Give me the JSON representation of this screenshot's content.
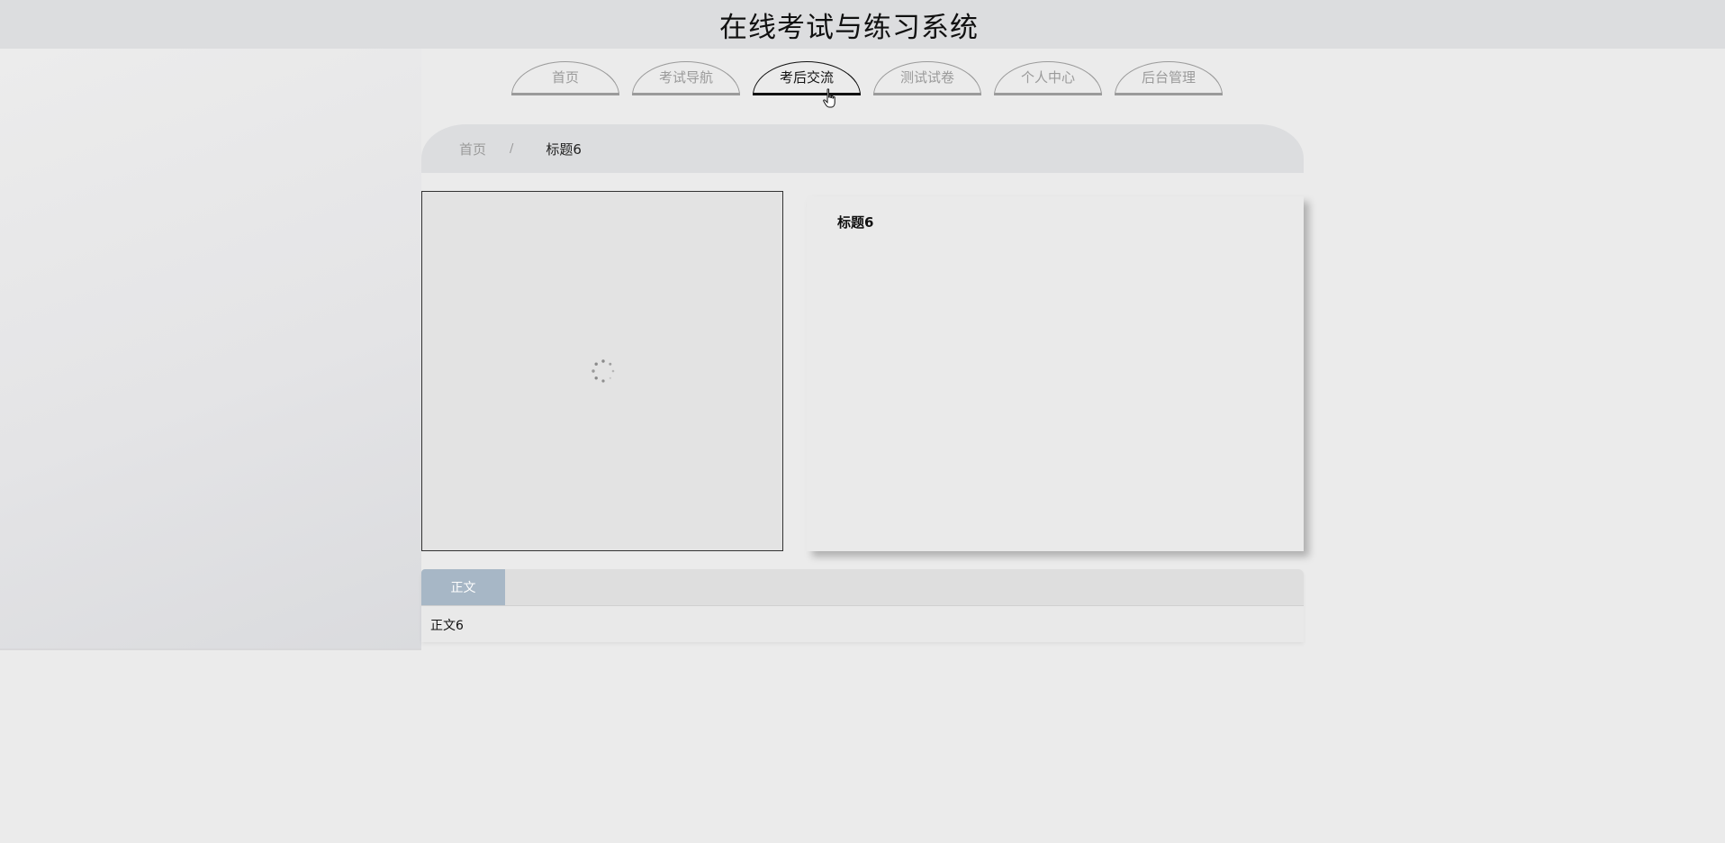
{
  "header": {
    "title": "在线考试与练习系统"
  },
  "nav": {
    "items": [
      {
        "label": "首页"
      },
      {
        "label": "考试导航"
      },
      {
        "label": "考后交流"
      },
      {
        "label": "测试试卷"
      },
      {
        "label": "个人中心"
      },
      {
        "label": "后台管理"
      }
    ],
    "active_index": 2
  },
  "breadcrumb": {
    "home": "首页",
    "separator": "/",
    "current": "标题6"
  },
  "detail": {
    "title": "标题6",
    "image_state": "loading-spinner-icon"
  },
  "tabs": {
    "items": [
      {
        "label": "正文"
      }
    ],
    "active_index": 0,
    "content": "正文6"
  },
  "colors": {
    "tab_active_bg": "#a7b7c6",
    "header_bg": "#dcdddf",
    "page_bg": "#ebebeb"
  }
}
